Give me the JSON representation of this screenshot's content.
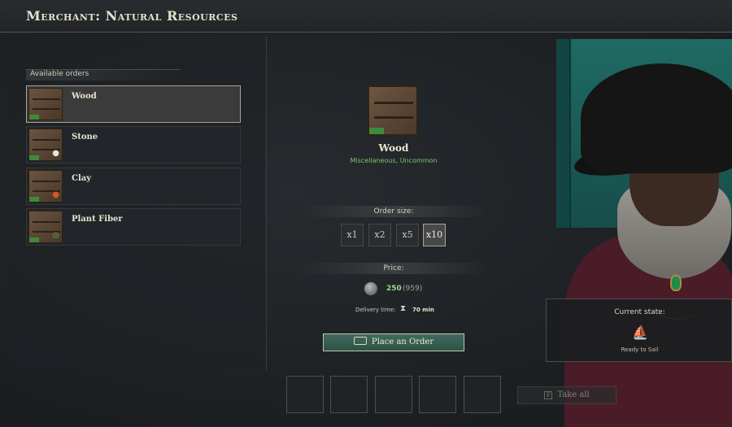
{
  "window": {
    "title": "Merchant: Natural Resources"
  },
  "orders": {
    "header": "Available orders",
    "items": [
      {
        "label": "Wood",
        "icon": "wood-crate-icon",
        "selected": true
      },
      {
        "label": "Stone",
        "icon": "stone-crate-icon",
        "selected": false
      },
      {
        "label": "Clay",
        "icon": "clay-crate-icon",
        "selected": false
      },
      {
        "label": "Plant Fiber",
        "icon": "plant-fiber-crate-icon",
        "selected": false
      }
    ]
  },
  "detail": {
    "item_name": "Wood",
    "item_subtitle": "Miscellaneous, Uncommon",
    "order_size_label": "Order size:",
    "sizes": [
      "x1",
      "x2",
      "x5",
      "x10"
    ],
    "selected_size": "x10",
    "price_label": "Price:",
    "price_value": "250",
    "price_owned": "(959)",
    "delivery_label": "Delivery time:",
    "delivery_value": "70 min",
    "order_button": "Place an Order"
  },
  "slots": {
    "count": 5
  },
  "take_all": {
    "label": "Take all",
    "key": "F"
  },
  "state": {
    "title": "Current state:",
    "value": "Ready to Sail"
  },
  "colors": {
    "accent_green": "#7fc46a",
    "button_teal": "#3f6b5d",
    "banner_teal": "#1f6a64",
    "price_green": "#9fd67f"
  }
}
